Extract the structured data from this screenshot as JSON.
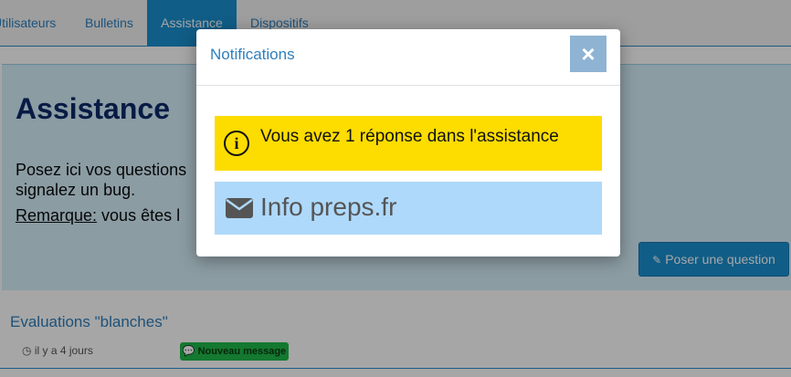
{
  "nav": {
    "tabs": [
      {
        "label": "Utilisateurs"
      },
      {
        "label": "Bulletins"
      },
      {
        "label": "Assistance"
      },
      {
        "label": "Dispositifs"
      }
    ]
  },
  "panel": {
    "title": "Assistance",
    "intro": "Posez ici vos questions signalez un bug.",
    "note_label": "Remarque:",
    "note_text": " vous êtes l",
    "ask_button": "Poser une question"
  },
  "list": {
    "title": "Evaluations \"blanches\"",
    "meta": "il y a 4 jours",
    "badge": "Nouveau message"
  },
  "modal": {
    "title": "Notifications",
    "close_label": "×",
    "alert_message": "Vous avez 1 réponse dans l'assistance",
    "info_message": "Info preps.fr"
  },
  "colors": {
    "accent": "#1a8fd0",
    "alert_yellow": "#fddc00",
    "info_blue": "#aed9fb",
    "badge_green": "#20b84a"
  },
  "icons": {
    "pencil": "pencil-icon",
    "info": "info-circle-icon",
    "envelope": "envelope-icon",
    "clock": "clock-icon",
    "chat": "chat-bubble-icon",
    "close": "close-icon"
  }
}
